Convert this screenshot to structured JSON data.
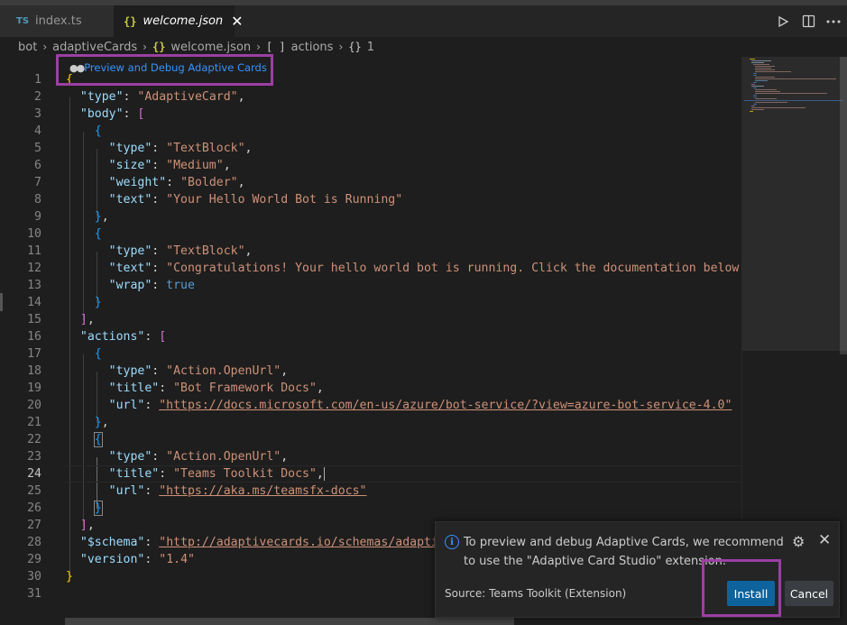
{
  "tabs": [
    {
      "badge": "TS",
      "label": "index.ts"
    },
    {
      "badge": "{}",
      "label": "welcome.json",
      "close": "✕"
    }
  ],
  "breadcrumb": {
    "items": [
      "bot",
      "adaptiveCards",
      "welcome.json",
      "actions",
      "1"
    ],
    "icons": [
      "",
      "",
      "{}",
      "[ ]",
      "{}"
    ]
  },
  "codelens": {
    "label": "Preview and Debug Adaptive Cards"
  },
  "editor": {
    "active_line": 24,
    "lines": [
      {
        "n": "1"
      },
      {
        "n": "2"
      },
      {
        "n": "3"
      },
      {
        "n": "4"
      },
      {
        "n": "5"
      },
      {
        "n": "6"
      },
      {
        "n": "7"
      },
      {
        "n": "8"
      },
      {
        "n": "9"
      },
      {
        "n": "10"
      },
      {
        "n": "11"
      },
      {
        "n": "12"
      },
      {
        "n": "13"
      },
      {
        "n": "14"
      },
      {
        "n": "15"
      },
      {
        "n": "16"
      },
      {
        "n": "17"
      },
      {
        "n": "18"
      },
      {
        "n": "19"
      },
      {
        "n": "20"
      },
      {
        "n": "21"
      },
      {
        "n": "22"
      },
      {
        "n": "23"
      },
      {
        "n": "24"
      },
      {
        "n": "25"
      },
      {
        "n": "26"
      },
      {
        "n": "27"
      },
      {
        "n": "28"
      },
      {
        "n": "29"
      },
      {
        "n": "30"
      },
      {
        "n": "31"
      }
    ],
    "strings": {
      "type_key": "\"type\"",
      "body_key": "\"body\"",
      "size_key": "\"size\"",
      "weight_key": "\"weight\"",
      "text_key": "\"text\"",
      "wrap_key": "\"wrap\"",
      "actions_key": "\"actions\"",
      "title_key": "\"title\"",
      "url_key": "\"url\"",
      "schema_key": "\"$schema\"",
      "version_key": "\"version\"",
      "adaptive_card": "\"AdaptiveCard\"",
      "textblock": "\"TextBlock\"",
      "medium": "\"Medium\"",
      "bolder": "\"Bolder\"",
      "hello_text": "\"Your Hello World Bot is Running\"",
      "congrats_text": "\"Congratulations! Your hello world bot is running. Click the documentation below to",
      "true_val": "true",
      "open_url": "\"Action.OpenUrl\"",
      "bot_docs": "\"Bot Framework Docs\"",
      "bot_docs_url": "\"https://docs.microsoft.com/en-us/azure/bot-service/?view=azure-bot-service-4.0\"",
      "teams_docs": "\"Teams Toolkit Docs\"",
      "teams_docs_url": "\"https://aka.ms/teamsfx-docs\"",
      "schema_url": "\"http://adaptivecards.io/schemas/adaptive",
      "version_val": "\"1.4\""
    }
  },
  "notification": {
    "message": "To preview and debug Adaptive Cards, we recommend to use the \"Adaptive Card Studio\" extension.",
    "source": "Source: Teams Toolkit (Extension)",
    "install_label": "Install",
    "cancel_label": "Cancel"
  },
  "colors": {
    "accent_highlight": "#9b3fa3",
    "button_primary": "#0e639c",
    "link": "#3794ff"
  },
  "icons": [
    "ts-file-icon",
    "json-file-icon",
    "run-icon",
    "split-editor-icon",
    "more-actions-icon",
    "info-icon",
    "gear-icon",
    "close-icon"
  ]
}
